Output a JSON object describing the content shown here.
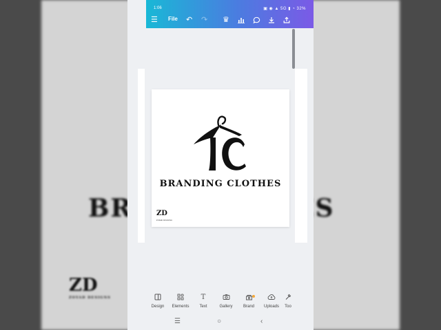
{
  "background": {
    "brand_left": "BRA",
    "brand_right": "ES",
    "zd": "ZD",
    "zd_sub": "ZOYAD DESIGNS"
  },
  "status_bar": {
    "time": "1:06",
    "right": "▣ ◉ ▲ 5G ▮ ◔ 32%"
  },
  "toolbar": {
    "menu_icon": "menu-icon",
    "file_label": "File",
    "undo_icon": "undo-icon",
    "redo_icon": "redo-icon",
    "crown_icon": "crown-icon",
    "chart_icon": "chart-icon",
    "comment_icon": "comment-icon",
    "download_icon": "download-icon",
    "share_icon": "share-icon"
  },
  "canvas": {
    "brand_text": "BRANDING CLOTHES",
    "zd": "ZD",
    "zd_sub": "ZOYAD DESIGNS"
  },
  "tabs": [
    {
      "label": "Design",
      "icon": "design-icon"
    },
    {
      "label": "Elements",
      "icon": "elements-icon"
    },
    {
      "label": "Text",
      "icon": "text-icon"
    },
    {
      "label": "Gallery",
      "icon": "camera-icon"
    },
    {
      "label": "Brand",
      "icon": "brand-icon"
    },
    {
      "label": "Uploads",
      "icon": "upload-icon"
    },
    {
      "label": "Too",
      "icon": "tools-icon"
    }
  ],
  "colors": {
    "gradient_start": "#19b8d6",
    "gradient_end": "#7b5ae6",
    "brand_dot": "#f3a73a"
  }
}
